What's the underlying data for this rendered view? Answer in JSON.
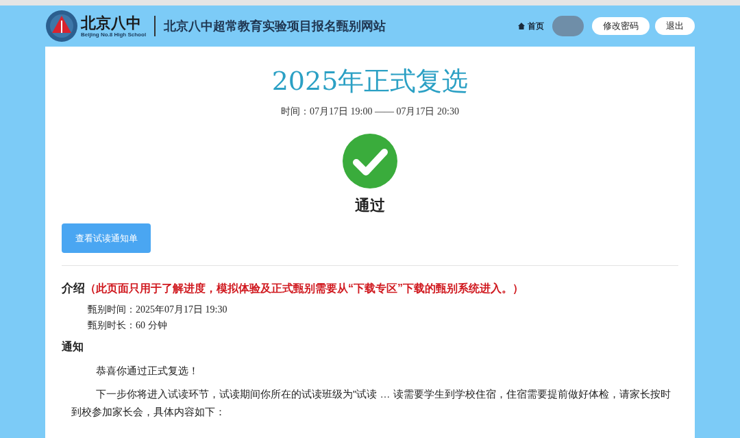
{
  "header": {
    "logo_text": "北京八中",
    "logo_subtext": "Beijing No.8 High School",
    "site_title": "北京八中超常教育实验项目报名甄别网站",
    "nav": [
      {
        "label": "首页",
        "kind": "link"
      }
    ],
    "buttons": [
      "修改密码",
      "退出"
    ]
  },
  "exam": {
    "title": "2025年正式复选",
    "time": "时间：07月17日 19:00 —— 07月17日 20:30",
    "status": "通过",
    "passed": true,
    "action_button": "查看试读通知单"
  },
  "intro": {
    "heading": "介绍",
    "note": "（此页面只用于了解进度，模拟体验及正式甄别需要从“下载专区”下载的甄别系统进入。）",
    "lines": [
      "甄别时间：2025年07月17日 19:30",
      "甄别时长：60 分钟"
    ]
  },
  "notice": {
    "heading": "通知",
    "paragraphs": [
      "恭喜你通过正式复选！",
      "下一步你将进入试读环节，试读期间你所在的试读班级为\"试读 … 读需要学生到学校住宿，住宿需要提前做好体检，请家长按时到校参加家长会，具体内容如下："
    ]
  }
}
